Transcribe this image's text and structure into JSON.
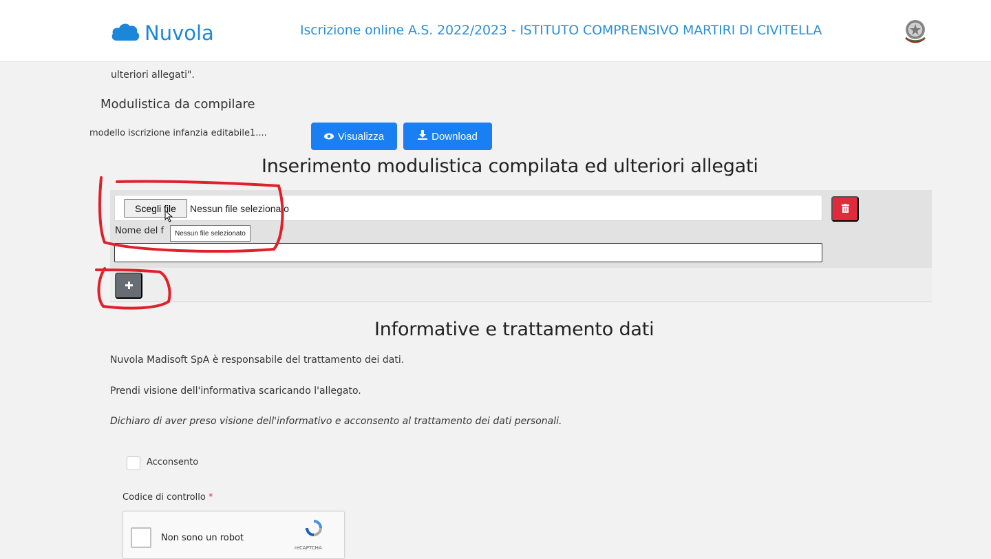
{
  "header": {
    "brand": "Nuvola",
    "title": "Iscrizione online A.S. 2022/2023 - ISTITUTO COMPRENSIVO MARTIRI DI CIVITELLA"
  },
  "intro_fragment": "ulteriori allegati\".",
  "modulistica": {
    "heading": "Modulistica da compilare",
    "file_name": "modello iscrizione infanzia editabile1....",
    "view_label": "Visualizza",
    "download_label": "Download"
  },
  "upload": {
    "heading": "Inserimento modulistica compilata ed ulteriori allegati",
    "choose_label": "Scegli file",
    "file_status": "Nessun file selezionato",
    "tooltip": "Nessun file selezionato",
    "name_label": "Nome del f"
  },
  "privacy": {
    "heading": "Informative e trattamento dati",
    "p1": "Nuvola Madisoft SpA è responsabile del trattamento dei dati.",
    "p2": "Prendi visione dell'informativa scaricando l'allegato.",
    "p3": "Dichiaro di aver preso visione dell'informativo e acconsento al trattamento dei dati personali.",
    "consent_label": "Acconsento",
    "code_label": "Codice di controllo",
    "required_mark": "*",
    "captcha_label": "Non sono un robot",
    "captcha_brand": "reCAPTCHA"
  },
  "colors": {
    "brand_blue": "#1c87d8",
    "primary_button": "#1a7ff2",
    "danger_button": "#e02b3b",
    "secondary_button": "#676d73",
    "annotation_red": "#e0202a"
  }
}
